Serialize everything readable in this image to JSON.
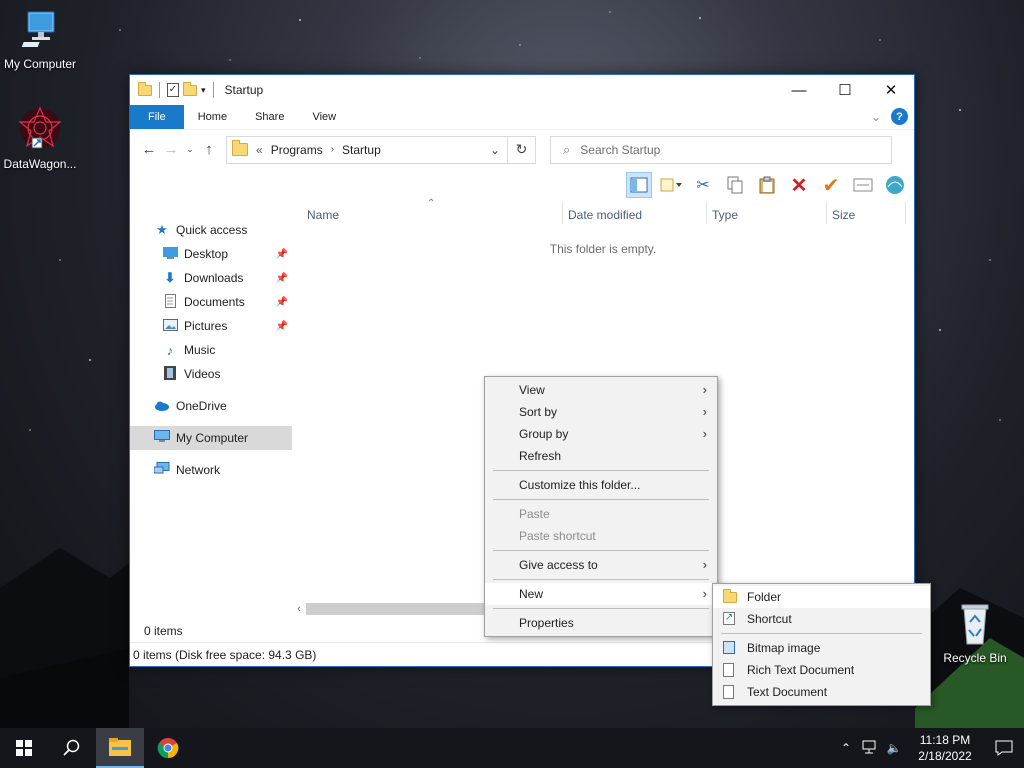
{
  "desktop": {
    "icons": [
      {
        "label": "My Computer",
        "icon": "computer-icon"
      },
      {
        "label": "DataWagon...",
        "icon": "datawagon-icon"
      },
      {
        "label": "Recycle Bin",
        "icon": "recycle-bin-icon"
      }
    ]
  },
  "window": {
    "title": "Startup",
    "ribbon_tabs": [
      "File",
      "Home",
      "Share",
      "View"
    ],
    "address": {
      "prefix": "«",
      "crumbs": [
        "Programs",
        "Startup"
      ]
    },
    "search_placeholder": "Search Startup",
    "nav": {
      "quick_access": "Quick access",
      "pinned": [
        "Desktop",
        "Downloads",
        "Documents",
        "Pictures"
      ],
      "unpinned": [
        "Music",
        "Videos"
      ],
      "onedrive": "OneDrive",
      "my_computer": "My Computer",
      "network": "Network"
    },
    "columns": [
      "Name",
      "Date modified",
      "Type",
      "Size"
    ],
    "empty_message": "This folder is empty.",
    "item_count": "0 items",
    "status_bar": "0 items (Disk free space: 94.3 GB)"
  },
  "context_menu": {
    "items": [
      "View",
      "Sort by",
      "Group by",
      "Refresh",
      "Customize this folder...",
      "Paste",
      "Paste shortcut",
      "Give access to",
      "New",
      "Properties"
    ]
  },
  "new_submenu": {
    "items": [
      "Folder",
      "Shortcut",
      "Bitmap image",
      "Rich Text Document",
      "Text Document"
    ]
  },
  "taskbar": {
    "time": "11:18 PM",
    "date": "2/18/2022"
  },
  "colors": {
    "accent": "#1979ca",
    "taskbar": "#14161b",
    "menu_bg": "#f2f2f2"
  }
}
